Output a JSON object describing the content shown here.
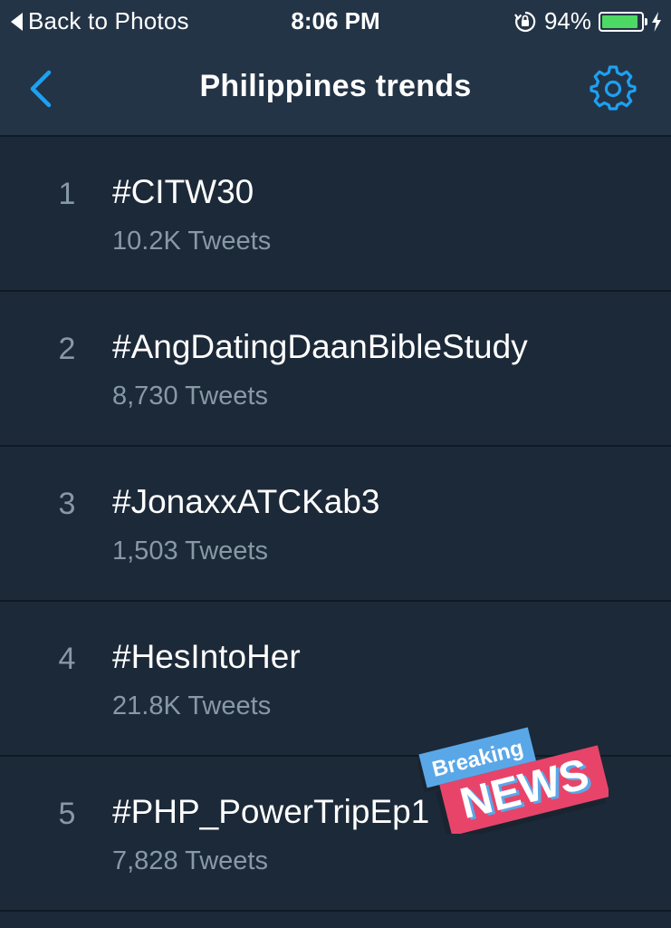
{
  "status_bar": {
    "back_label": "Back to Photos",
    "time": "8:06 PM",
    "battery_percent_label": "94%",
    "battery_level": 0.94
  },
  "nav": {
    "title": "Philippines trends",
    "back_icon": "chevron-left-icon",
    "settings_icon": "gear-icon"
  },
  "trends": [
    {
      "rank": "1",
      "tag": "#CITW30",
      "count": "10.2K Tweets"
    },
    {
      "rank": "2",
      "tag": "#AngDatingDaanBibleStudy",
      "count": "8,730 Tweets"
    },
    {
      "rank": "3",
      "tag": "#JonaxxATCKab3",
      "count": "1,503 Tweets"
    },
    {
      "rank": "4",
      "tag": "#HesIntoHer",
      "count": "21.8K Tweets"
    },
    {
      "rank": "5",
      "tag": "#PHP_PowerTripEp1",
      "count": "7,828 Tweets"
    }
  ],
  "sticker": {
    "line1": "Breaking",
    "line2": "NEWS"
  },
  "colors": {
    "background": "#1c2938",
    "header": "#243447",
    "accent": "#1da1f2",
    "secondary_text": "#8899a6",
    "battery_green": "#4cd964",
    "sticker_blue": "#5aa7e8",
    "sticker_red": "#e8446a"
  }
}
